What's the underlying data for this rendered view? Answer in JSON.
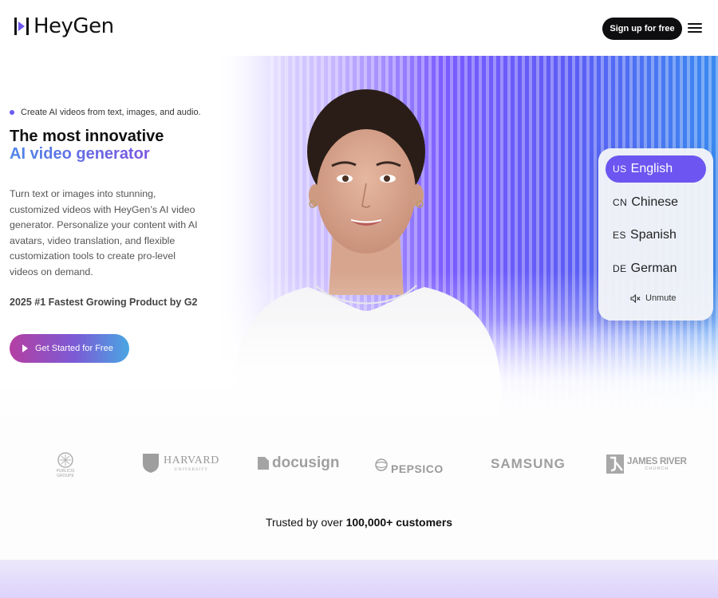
{
  "header": {
    "logo_text": "HeyGen",
    "signup_label": "Sign up for free"
  },
  "hero": {
    "tagline": "Create AI videos from text, images, and audio.",
    "title_line1": "The most innovative",
    "title_line2": "AI video generator",
    "description": "Turn text or images into stunning, customized videos with HeyGen’s AI video generator. Personalize your content with AI avatars, video translation, and flexible customization tools to create pro-level videos on demand.",
    "award": "2025 #1 Fastest Growing Product by G2",
    "cta_label": "Get Started for Free"
  },
  "languages": {
    "items": [
      {
        "code": "US",
        "label": "English",
        "active": true
      },
      {
        "code": "CN",
        "label": "Chinese",
        "active": false
      },
      {
        "code": "ES",
        "label": "Spanish",
        "active": false
      },
      {
        "code": "DE",
        "label": "German",
        "active": false
      }
    ],
    "unmute_label": "Unmute"
  },
  "customers": {
    "logos": [
      {
        "name": "publicis-groupe",
        "text": "PUBLICIS GROUPE"
      },
      {
        "name": "harvard",
        "text": "HARVARD",
        "sub": "UNIVERSITY"
      },
      {
        "name": "docusign",
        "text": "docusign"
      },
      {
        "name": "pepsico",
        "text": "PEPSICO"
      },
      {
        "name": "samsung",
        "text": "SAMSUNG"
      },
      {
        "name": "james-river",
        "text": "JAMES RIVER",
        "sub": "CHURCH"
      }
    ],
    "trusted_prefix": "Trusted by over",
    "trusted_count": "100,000+ customers"
  },
  "colors": {
    "accent": "#6c55f0",
    "button_dark": "#0e0e10",
    "cta_start": "#b43fa2",
    "cta_end": "#4aa6e2"
  }
}
